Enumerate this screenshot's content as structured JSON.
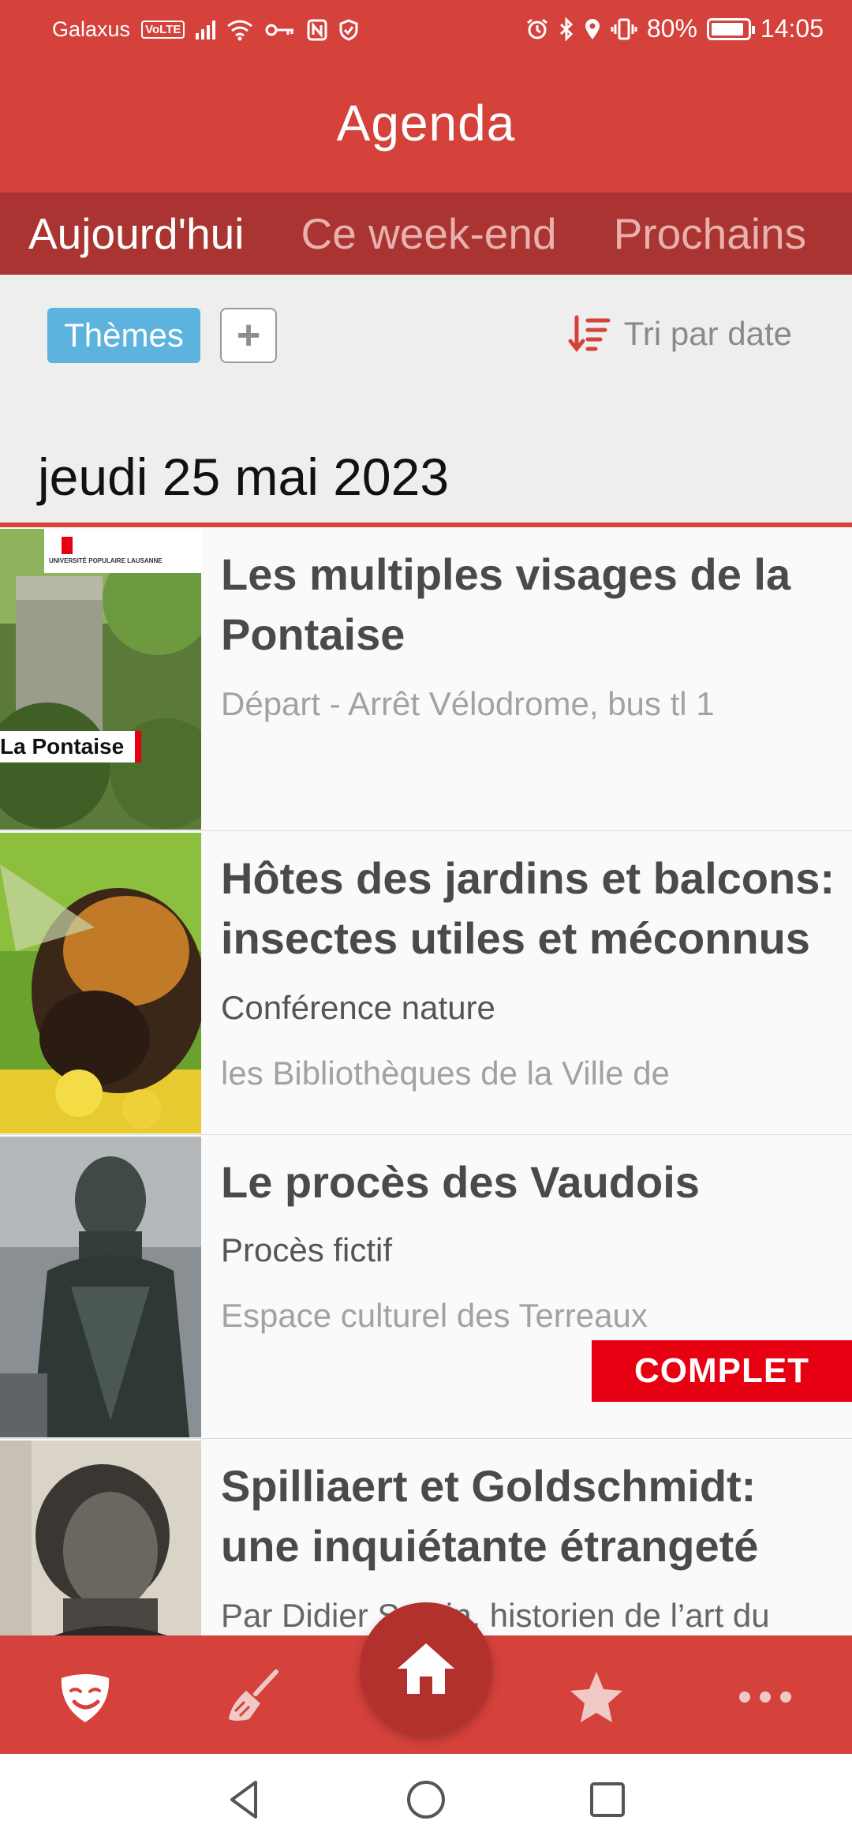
{
  "status_bar": {
    "carrier": "Galaxus",
    "volte": "VoLTE",
    "battery": "80%",
    "time": "14:05"
  },
  "app": {
    "title": "Agenda"
  },
  "tabs": [
    {
      "label": "Aujourd'hui",
      "active": true
    },
    {
      "label": "Ce week-end",
      "active": false
    },
    {
      "label": "Prochains",
      "active": false
    }
  ],
  "filters": {
    "themes_label": "Thèmes",
    "add_label": "+",
    "sort_label": "Tri par date"
  },
  "date_header": "jeudi 25 mai 2023",
  "events": [
    {
      "title": "Les multiples visages de la Pontaise",
      "subtitle": "",
      "location": "Départ - Arrêt Vélodrome, bus tl 1",
      "thumb_caption": "La Pontaise",
      "thumb_brand": "UNIVERSITÉ POPULAIRE LAUSANNE",
      "badge": ""
    },
    {
      "title": "Hôtes des jardins et balcons: insectes utiles et méconnus",
      "subtitle": "Conférence nature",
      "location": "les Bibliothèques de la Ville de",
      "badge": ""
    },
    {
      "title": "Le procès des Vaudois",
      "subtitle": "Procès fictif",
      "location": "Espace culturel des Terreaux",
      "badge": "COMPLET"
    },
    {
      "title": "Spilliaert et Goldschmidt: une inquiétante étrangeté",
      "subtitle": "Par Didier Semin, historien de l’art du",
      "location": "",
      "badge": ""
    }
  ],
  "bottom_nav": [
    {
      "icon": "theater-mask-icon"
    },
    {
      "icon": "broom-icon"
    },
    {
      "icon": "home-icon"
    },
    {
      "icon": "star-icon"
    },
    {
      "icon": "more-dots-icon"
    }
  ],
  "colors": {
    "primary": "#d5413b",
    "tab_bar": "#a93431",
    "themes_button": "#5cb3dd",
    "complet_badge": "#e60012"
  }
}
